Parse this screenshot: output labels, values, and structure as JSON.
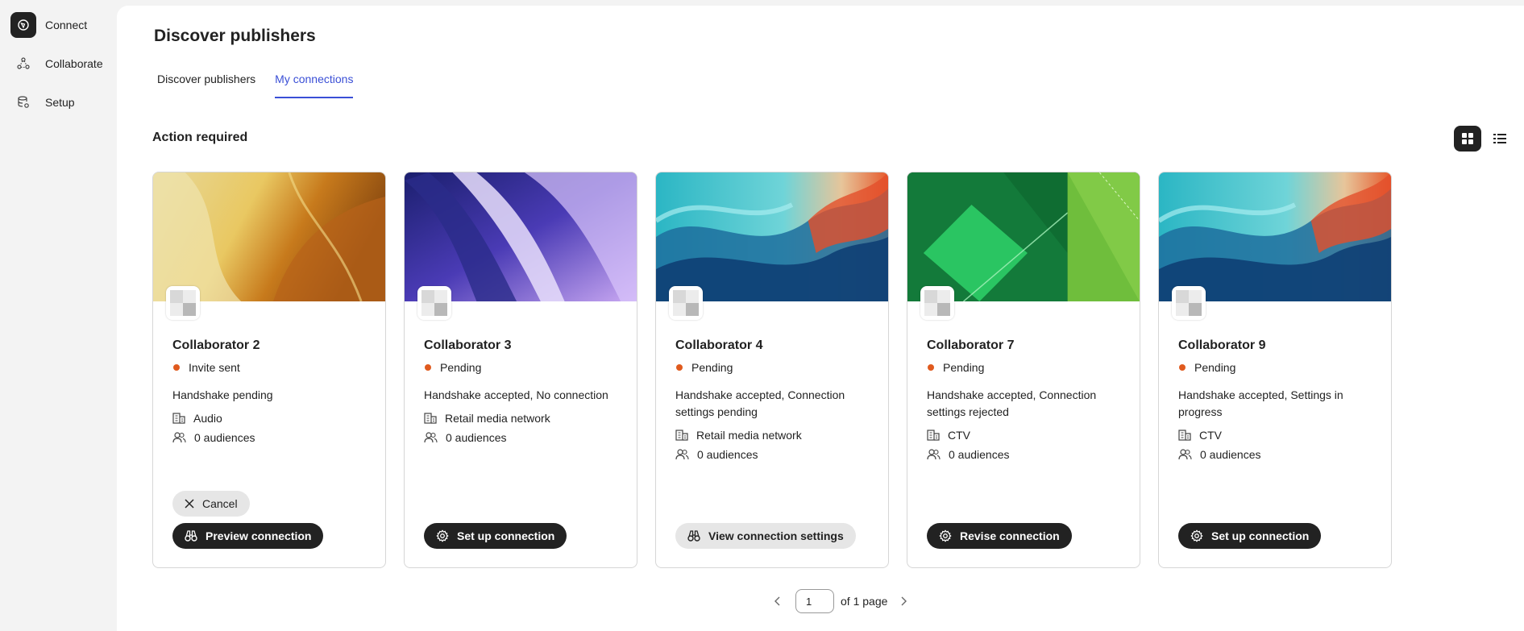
{
  "sidebar": {
    "items": [
      {
        "label": "Connect",
        "icon": "connect-icon",
        "active": true
      },
      {
        "label": "Collaborate",
        "icon": "collaborate-icon"
      },
      {
        "label": "Setup",
        "icon": "setup-icon"
      }
    ]
  },
  "page": {
    "title": "Discover publishers",
    "tabs": [
      {
        "label": "Discover publishers"
      },
      {
        "label": "My connections",
        "active": true
      }
    ],
    "section_title": "Action required"
  },
  "cards": [
    {
      "name": "Collaborator 2",
      "status": "Invite sent",
      "description": "Handshake pending",
      "category": "Audio",
      "audiences": "0 audiences",
      "cancel_label": "Cancel",
      "action_label": "Preview connection"
    },
    {
      "name": "Collaborator 3",
      "status": "Pending",
      "description": "Handshake accepted, No connection",
      "category": "Retail media network",
      "audiences": "0 audiences",
      "action_label": "Set up connection"
    },
    {
      "name": "Collaborator 4",
      "status": "Pending",
      "description": "Handshake accepted, Connection settings pending",
      "category": "Retail media network",
      "audiences": "0 audiences",
      "action_label": "View connection settings"
    },
    {
      "name": "Collaborator 7",
      "status": "Pending",
      "description": "Handshake accepted, Connection settings rejected",
      "category": "CTV",
      "audiences": "0 audiences",
      "action_label": "Revise connection"
    },
    {
      "name": "Collaborator 9",
      "status": "Pending",
      "description": "Handshake accepted, Settings in progress",
      "category": "CTV",
      "audiences": "0 audiences",
      "action_label": "Set up connection"
    }
  ],
  "pagination": {
    "page_value": "1",
    "of_text": "of 1 page"
  },
  "colors": {
    "accent": "#3a4fd6",
    "status_dot": "#e05a1e",
    "dark_button": "#222222"
  }
}
